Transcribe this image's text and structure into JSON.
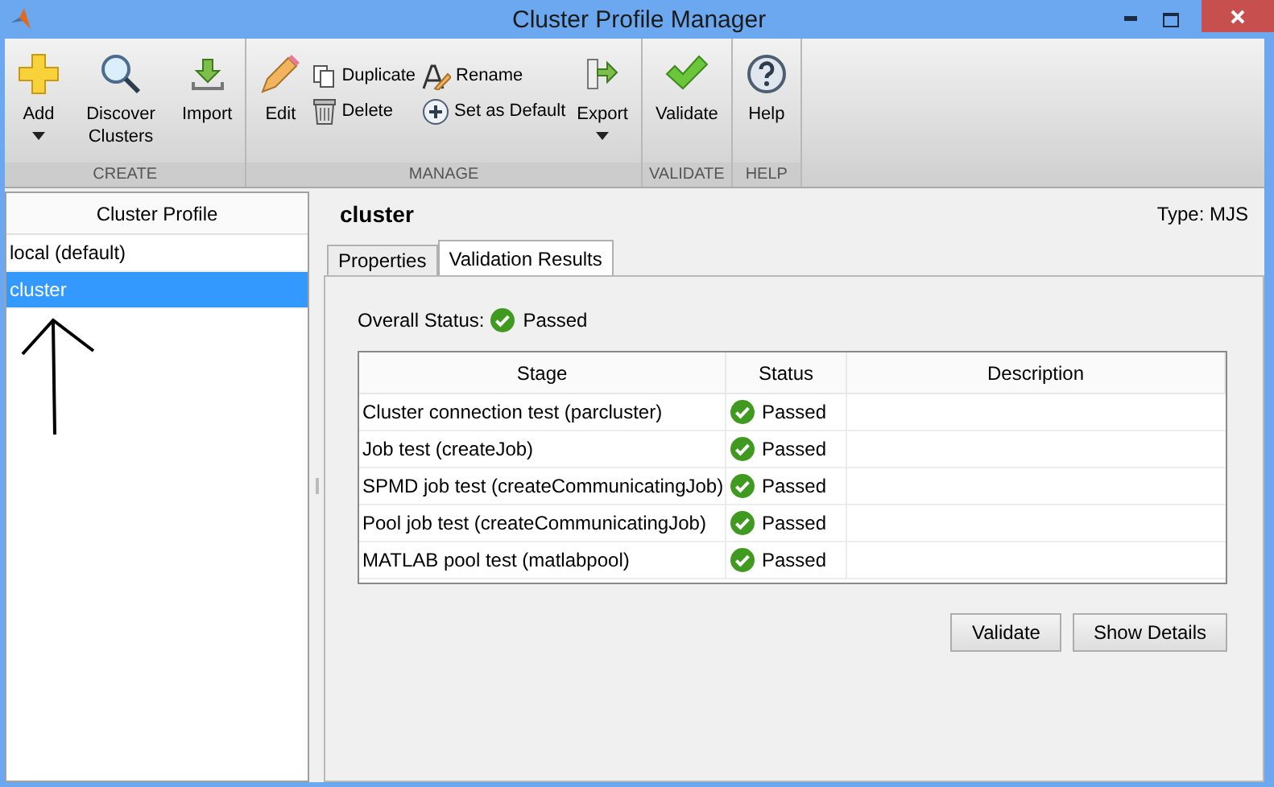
{
  "window": {
    "title": "Cluster Profile Manager"
  },
  "toolbar": {
    "groups": [
      {
        "label": "CREATE",
        "items": [
          {
            "kind": "large",
            "label": "Add",
            "dropdown": true
          },
          {
            "kind": "large",
            "label": "Discover Clusters",
            "dropdown": false
          },
          {
            "kind": "large",
            "label": "Import",
            "dropdown": false
          }
        ]
      },
      {
        "label": "MANAGE",
        "items": [
          {
            "kind": "large",
            "label": "Edit",
            "dropdown": false
          },
          {
            "kind": "stack",
            "buttons": [
              {
                "label": "Duplicate"
              },
              {
                "label": "Delete"
              }
            ]
          },
          {
            "kind": "stack",
            "buttons": [
              {
                "label": "Rename"
              },
              {
                "label": "Set as Default"
              }
            ]
          },
          {
            "kind": "large",
            "label": "Export",
            "dropdown": true
          }
        ]
      },
      {
        "label": "VALIDATE",
        "items": [
          {
            "kind": "large",
            "label": "Validate",
            "dropdown": false
          }
        ]
      },
      {
        "label": "HELP",
        "items": [
          {
            "kind": "large",
            "label": "Help",
            "dropdown": false
          }
        ]
      }
    ]
  },
  "sidebar": {
    "heading": "Cluster Profile",
    "items": [
      {
        "label": "local (default)",
        "selected": false
      },
      {
        "label": "cluster",
        "selected": true
      }
    ]
  },
  "profile": {
    "name": "cluster",
    "type": "Type: MJS"
  },
  "tabs": [
    {
      "label": "Properties",
      "selected": false
    },
    {
      "label": "Validation Results",
      "selected": true
    }
  ],
  "overall_status": {
    "label": "Overall Status:",
    "value": "Passed"
  },
  "table": {
    "columns": [
      "Stage",
      "Status",
      "Description"
    ],
    "rows": [
      {
        "stage": "Cluster connection test (parcluster)",
        "status": "Passed"
      },
      {
        "stage": "Job test (createJob)",
        "status": "Passed"
      },
      {
        "stage": "SPMD job test (createCommunicatingJob)",
        "status": "Passed"
      },
      {
        "stage": "Pool job test (createCommunicatingJob)",
        "status": "Passed"
      },
      {
        "stage": "MATLAB pool test (matlabpool)",
        "status": "Passed"
      }
    ]
  },
  "buttons": [
    "Validate",
    "Show Details"
  ]
}
